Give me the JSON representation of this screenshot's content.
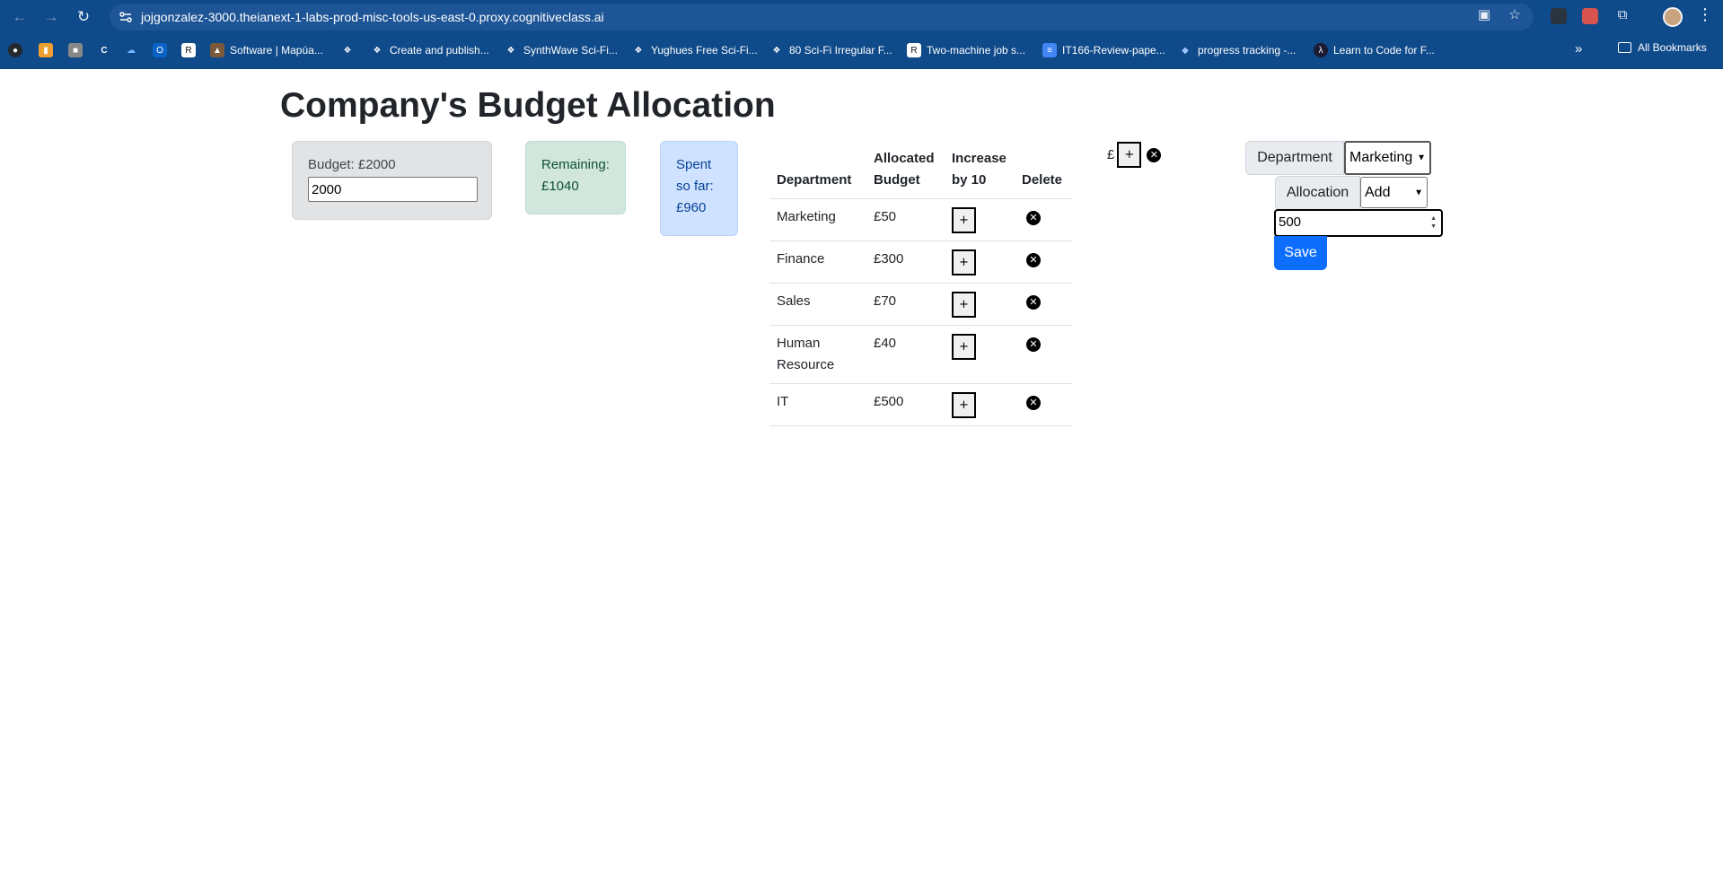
{
  "browser": {
    "url": "jojgonzalez-3000.theianext-1-labs-prod-misc-tools-us-east-0.proxy.cognitiveclass.ai",
    "bookmarks": [
      "Software | Mapúa...",
      "Create and publish...",
      "SynthWave Sci-Fi...",
      "Yughues Free Sci-Fi...",
      "80 Sci-Fi Irregular F...",
      "Two-machine job s...",
      "IT166-Review-pape...",
      "progress tracking -...",
      "Learn to Code for F..."
    ],
    "all_bookmarks": "All Bookmarks",
    "colors": {
      "toolbar": "#0f4a8a",
      "omnibox": "#1d5596"
    }
  },
  "page": {
    "title": "Company's Budget Allocation",
    "budget": {
      "label": "Budget: £2000",
      "input_value": "2000"
    },
    "remaining": {
      "label": "Remaining: £1040"
    },
    "spent": {
      "label": "Spent so far: £960"
    },
    "table": {
      "headers": [
        "Department",
        "Allocated Budget",
        "Increase by 10",
        "Delete"
      ],
      "rows": [
        {
          "department": "Marketing",
          "budget": "£50"
        },
        {
          "department": "Finance",
          "budget": "£300"
        },
        {
          "department": "Sales",
          "budget": "£70"
        },
        {
          "department": "Human Resource",
          "budget": "£40"
        },
        {
          "department": "IT",
          "budget": "£500"
        }
      ],
      "increase_symbol": "+",
      "delete_symbol": "✕"
    },
    "stray_row": {
      "currency": "£",
      "increase_symbol": "+",
      "delete_symbol": "✕"
    },
    "form": {
      "department_label": "Department",
      "department_selected": "Marketing",
      "allocation_label": "Allocation",
      "allocation_selected": "Add",
      "amount_value": "500",
      "save_label": "Save",
      "colors": {
        "save": "#0d6efd"
      }
    }
  }
}
